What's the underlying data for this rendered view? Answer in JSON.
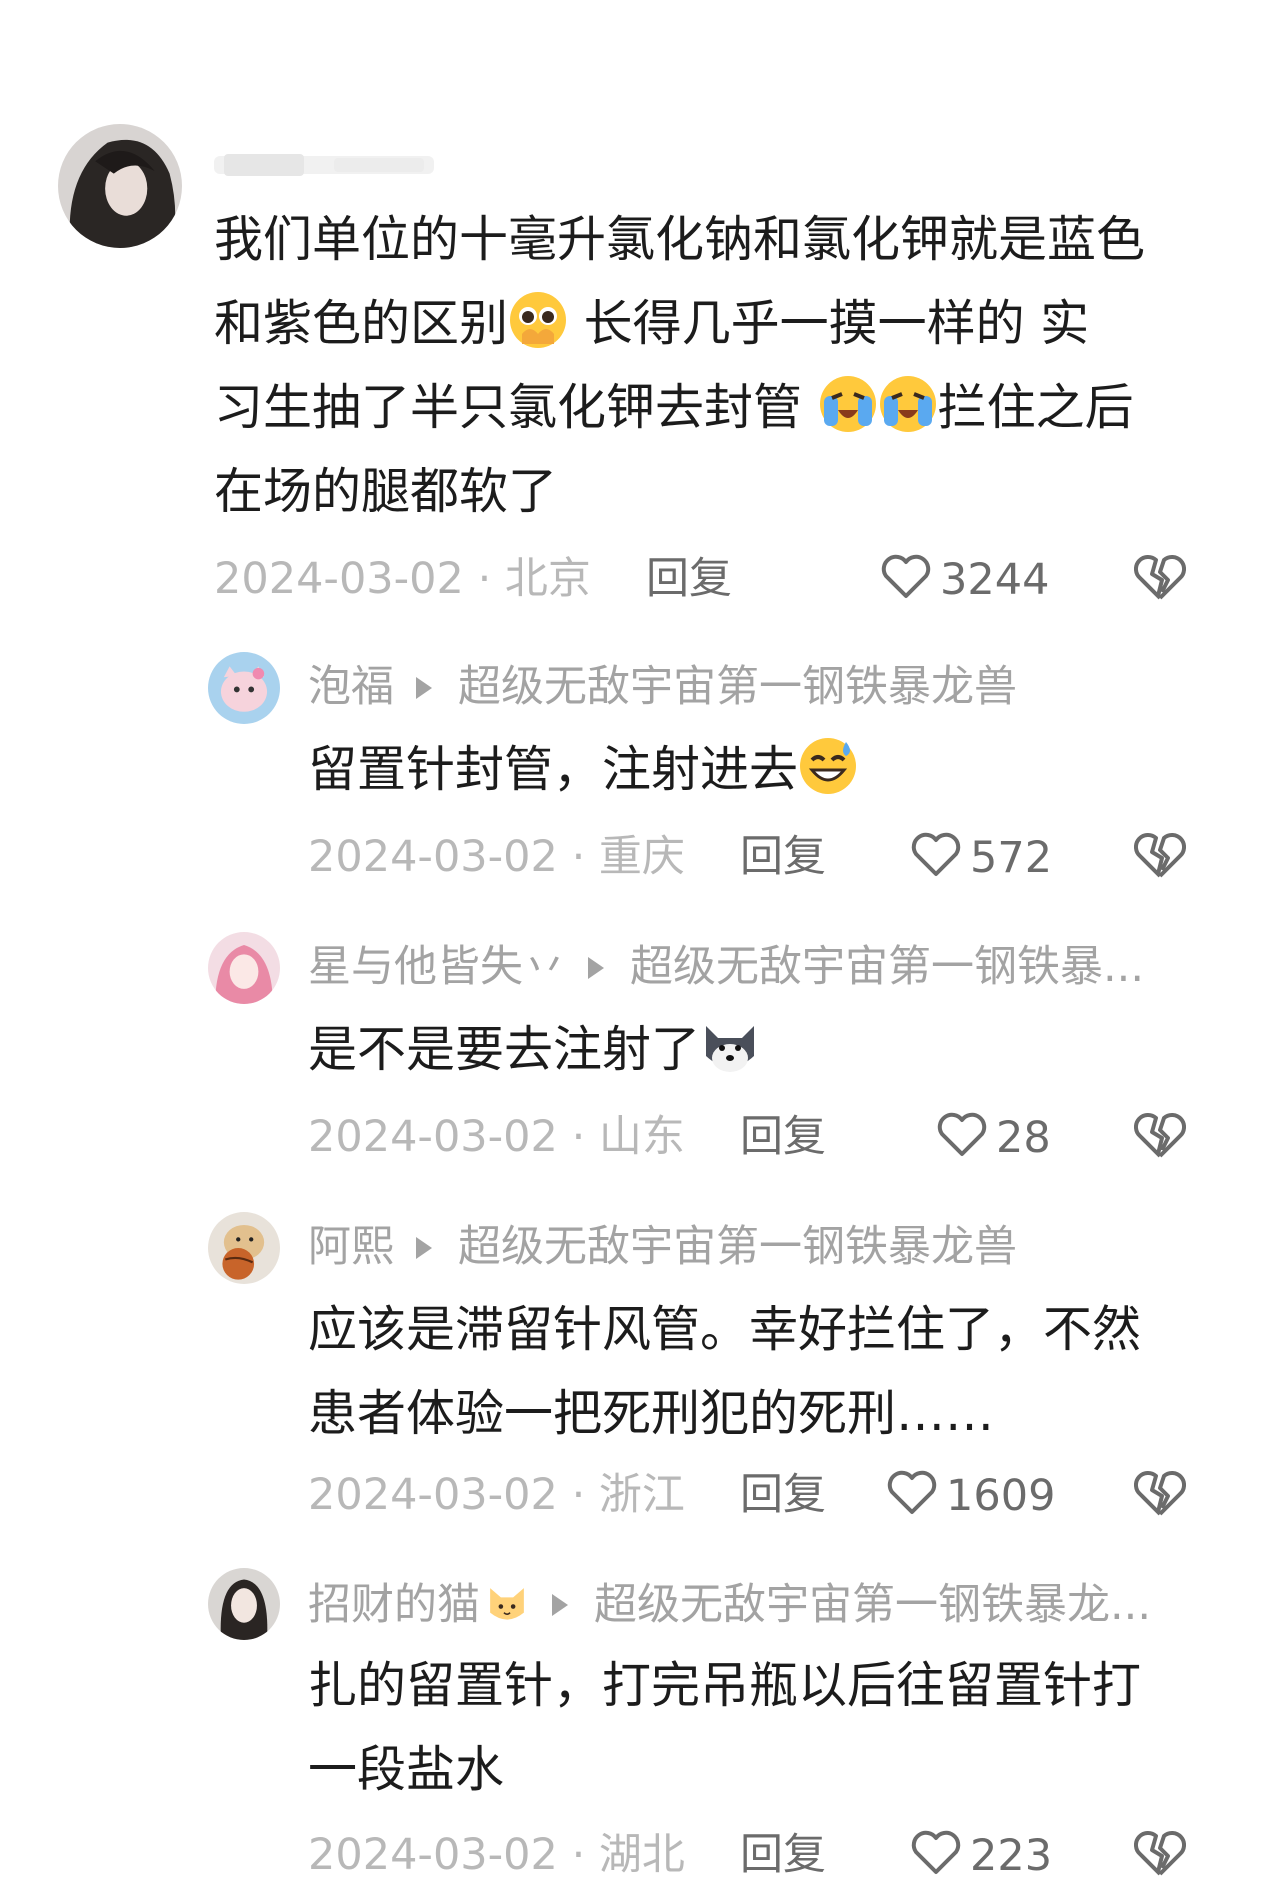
{
  "comments": [
    {
      "username": "",
      "text_lines": [
        "我们单位的十毫升氯化钠和氯化钾就是蓝色",
        "和紫色的区别",
        " 长得几乎一摸一样的 实",
        "习生抽了半只氯化钾去封管 ",
        "拦住之后",
        "在场的腿都软了"
      ],
      "date": "2024-03-02",
      "location": "北京",
      "reply_label": "回复",
      "likes": "3244"
    },
    {
      "username": "泡福",
      "reply_to": "超级无敌宇宙第一钢铁暴龙兽",
      "text": "留置针封管，注射进去",
      "date": "2024-03-02",
      "location": "重庆",
      "reply_label": "回复",
      "likes": "572"
    },
    {
      "username": "星与他皆失丷",
      "reply_to": "超级无敌宇宙第一钢铁暴...",
      "text": "是不是要去注射了",
      "date": "2024-03-02",
      "location": "山东",
      "reply_label": "回复",
      "likes": "28"
    },
    {
      "username": "阿熙",
      "reply_to": "超级无敌宇宙第一钢铁暴龙兽",
      "text_lines": [
        "应该是滞留针风管。幸好拦住了，不然",
        "患者体验一把死刑犯的死刑……"
      ],
      "date": "2024-03-02",
      "location": "浙江",
      "reply_label": "回复",
      "likes": "1609"
    },
    {
      "username": "招财的猫",
      "reply_to": "超级无敌宇宙第一钢铁暴龙...",
      "text_lines": [
        "扎的留置针，打完吊瓶以后往留置针打",
        "一段盐水"
      ],
      "date": "2024-03-02",
      "location": "湖北",
      "reply_label": "回复",
      "likes": "223"
    }
  ],
  "separator": " · ",
  "icons": {
    "like": "heart-outline-icon",
    "dislike": "broken-heart-icon",
    "reply_arrow": "triangle-right-icon",
    "emoji_pleading": "pleading-face-emoji",
    "emoji_crying": "loudly-crying-face-emoji",
    "emoji_sweat": "grinning-sweat-emoji",
    "emoji_dog": "husky-dog-emoji",
    "emoji_cat": "cat-face-emoji"
  },
  "colors": {
    "primary_text": "#1c1c1c",
    "secondary_text": "#a3a3a3",
    "meta_text": "#b8b8b8",
    "icon": "#6b6b6b"
  }
}
